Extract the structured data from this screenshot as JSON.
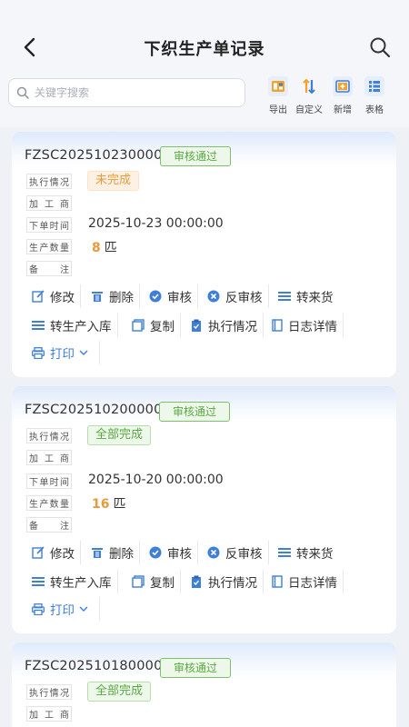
{
  "header": {
    "title": "下织生产单记录"
  },
  "search": {
    "placeholder": "关键字搜索"
  },
  "toolbar": [
    {
      "label": "导出",
      "icon": "export-icon"
    },
    {
      "label": "自定义",
      "icon": "custom-sort-icon"
    },
    {
      "label": "新增",
      "icon": "add-icon"
    },
    {
      "label": "表格",
      "icon": "table-icon"
    }
  ],
  "labels": {
    "status": "执行情况",
    "processor": "加工商",
    "order_time": "下单时间",
    "quantity": "生产数量",
    "remark": "备注"
  },
  "actions": {
    "edit": "修改",
    "delete": "删除",
    "approve": "审核",
    "unapprove": "反审核",
    "transfer_in": "转来货",
    "to_warehouse": "转生产入库",
    "copy": "复制",
    "exec_status": "执行情况",
    "log_detail": "日志详情",
    "print": "打印"
  },
  "orders": [
    {
      "code": "FZSC2025102300001",
      "approval": "审核通过",
      "status": "未完成",
      "status_color": "#e89a3c",
      "order_time": "2025-10-23 00:00:00",
      "qty": "8",
      "unit": "匹"
    },
    {
      "code": "FZSC2025102000001",
      "approval": "审核通过",
      "status": "全部完成",
      "status_color": "#5aa843",
      "order_time": "2025-10-20 00:00:00",
      "qty": "16",
      "unit": "匹"
    },
    {
      "code": "FZSC2025101800007",
      "approval": "审核通过",
      "status": "全部完成",
      "status_color": "#5aa843"
    }
  ]
}
